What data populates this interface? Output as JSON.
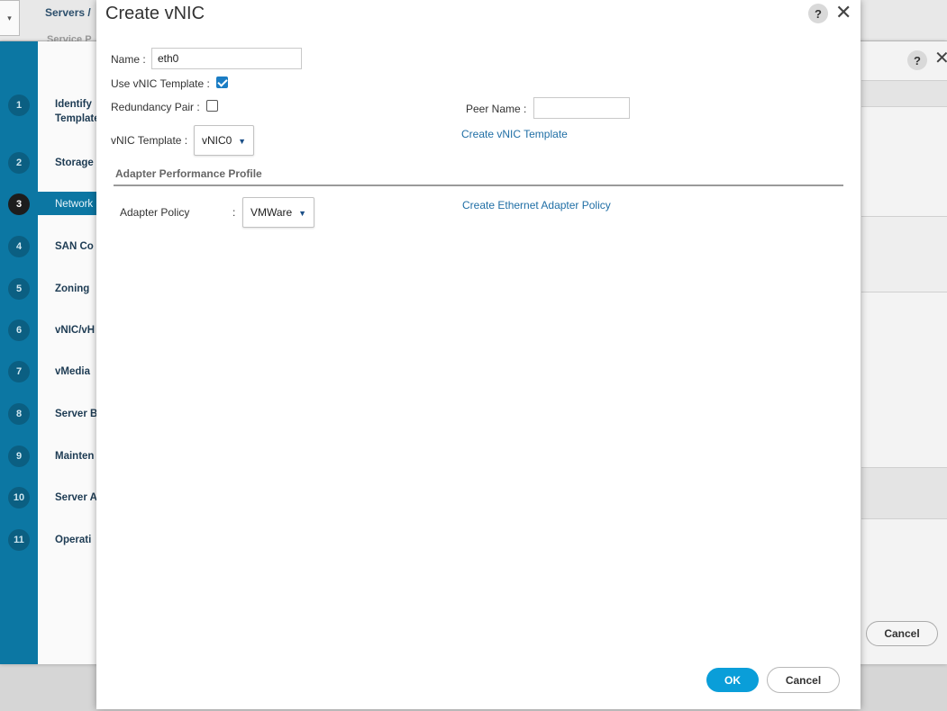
{
  "background": {
    "breadcrumb": "Servers /",
    "breadcrumb_sub": "Service P",
    "wizard_steps": [
      {
        "num": "1",
        "label": "Identify Template"
      },
      {
        "num": "2",
        "label": "Storage"
      },
      {
        "num": "3",
        "label": "Network"
      },
      {
        "num": "4",
        "label": "SAN Co"
      },
      {
        "num": "5",
        "label": "Zoning"
      },
      {
        "num": "6",
        "label": "vNIC/vH"
      },
      {
        "num": "7",
        "label": "vMedia"
      },
      {
        "num": "8",
        "label": "Server B"
      },
      {
        "num": "9",
        "label": "Mainten"
      },
      {
        "num": "10",
        "label": "Server A"
      },
      {
        "num": "11",
        "label": "Operati"
      }
    ],
    "help_label": "?",
    "close_label": "✕",
    "cancel_label": "Cancel"
  },
  "modal": {
    "title": "Create vNIC",
    "help_label": "?",
    "close_label": "✕",
    "name_label": "Name :",
    "name_value": "eth0",
    "use_template_label": "Use vNIC Template :",
    "use_template_checked": true,
    "redundancy_label": "Redundancy Pair :",
    "redundancy_checked": false,
    "peer_name_label": "Peer Name :",
    "peer_name_value": "",
    "template_label": "vNIC Template :",
    "template_value": "vNIC0",
    "create_template_link": "Create vNIC Template",
    "section_title": "Adapter Performance Profile",
    "adapter_policy_label": "Adapter Policy",
    "adapter_policy_colon": ":",
    "adapter_policy_value": "VMWare",
    "create_adapter_policy_link": "Create Ethernet Adapter Policy",
    "ok_label": "OK",
    "cancel_label": "Cancel"
  },
  "icons": {
    "caret": "▼"
  },
  "colors": {
    "wizard_sidebar": "#0c77a3",
    "primary_button": "#0a9ed9",
    "link": "#1f6ea5",
    "checkbox_checked": "#1b7dc4"
  }
}
